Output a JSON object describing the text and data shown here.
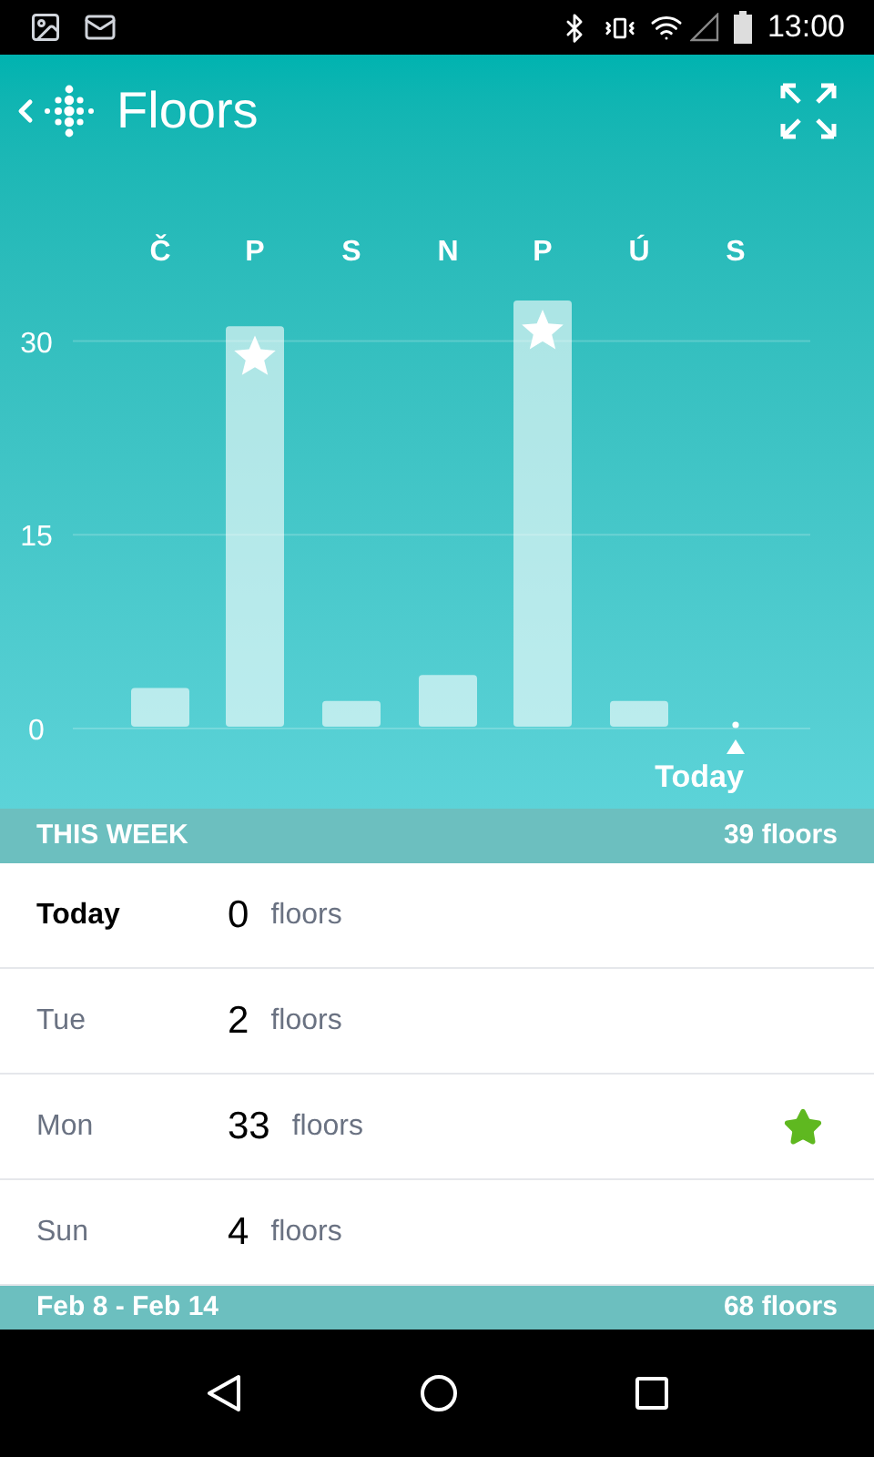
{
  "status_bar": {
    "time": "13:00"
  },
  "header": {
    "title": "Floors"
  },
  "chart": {
    "chart_data": {
      "type": "bar",
      "categories": [
        "Č",
        "P",
        "S",
        "N",
        "P",
        "Ú",
        "S"
      ],
      "values": [
        3,
        31,
        2,
        4,
        33,
        2,
        0
      ],
      "yticks": [
        0,
        15,
        30
      ],
      "ylim": [
        0,
        33
      ]
    },
    "goal_reached": [
      false,
      true,
      false,
      false,
      true,
      false,
      false
    ],
    "today_label": "Today"
  },
  "summary": {
    "label": "THIS WEEK",
    "total": "39 floors"
  },
  "days": [
    {
      "day": "Today",
      "count": "0",
      "unit": "floors",
      "current": true,
      "star": false
    },
    {
      "day": "Tue",
      "count": "2",
      "unit": "floors",
      "current": false,
      "star": false
    },
    {
      "day": "Mon",
      "count": "33",
      "unit": "floors",
      "current": false,
      "star": true
    },
    {
      "day": "Sun",
      "count": "4",
      "unit": "floors",
      "current": false,
      "star": false
    }
  ],
  "next_section": {
    "label": "Feb 8 - Feb 14",
    "total": "68 floors"
  }
}
